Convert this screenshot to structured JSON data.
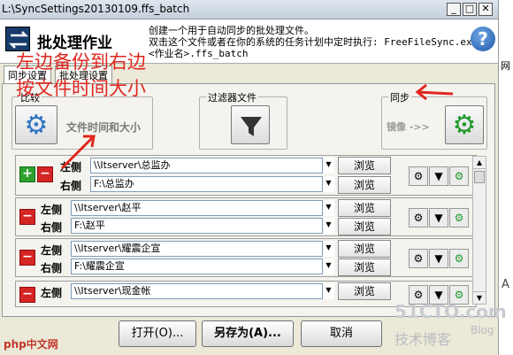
{
  "window": {
    "title": "L:\\SyncSettings20130109.ffs_batch"
  },
  "header": {
    "title": "批处理作业",
    "line1": "创建一个用于自动同步的批处理文件。",
    "line2": "双击这个文件或者在你的系统的任务计划中定时执行: FreeFileSync.exe",
    "line3": "<作业名>.ffs_batch"
  },
  "tabs": [
    {
      "label": "同步设置"
    },
    {
      "label": "批处理设置"
    }
  ],
  "groups": {
    "compare": {
      "label": "比较",
      "value": "文件时间和大小"
    },
    "filter": {
      "label": "过滤器文件"
    },
    "sync": {
      "label": "同步",
      "value": "镜像 ->>"
    }
  },
  "pairs": [
    {
      "left_label": "左侧",
      "left_path": "\\\\Itserver\\总监办",
      "right_label": "右侧",
      "right_path": "F:\\总监办"
    },
    {
      "left_label": "左侧",
      "left_path": "\\\\Itserver\\赵平",
      "right_label": "右侧",
      "right_path": "F:\\赵平"
    },
    {
      "left_label": "左侧",
      "left_path": "\\\\Itserver\\耀震企宣",
      "right_label": "右侧",
      "right_path": "F:\\耀震企宣"
    },
    {
      "left_label": "左侧",
      "left_path": "\\\\Itserver\\现金帐",
      "right_label": "",
      "right_path": ""
    }
  ],
  "browse_label": "浏览",
  "buttons": {
    "open": "打开(O)...",
    "save_as": "另存为(A)...",
    "cancel": "取消"
  },
  "annotations": {
    "line1": "左边备份到右边",
    "line2": "按文件时间大小"
  },
  "watermark": {
    "site": "51CTO.com",
    "blog": "技术博客",
    "blog_tag": "Blog",
    "brand": "php中文网"
  },
  "right_strip": {
    "char1": "网",
    "char2": "A"
  },
  "colors": {
    "annotation": "#e0261f",
    "accent": "#2f74c4",
    "gear_green": "#1f9a2a"
  }
}
